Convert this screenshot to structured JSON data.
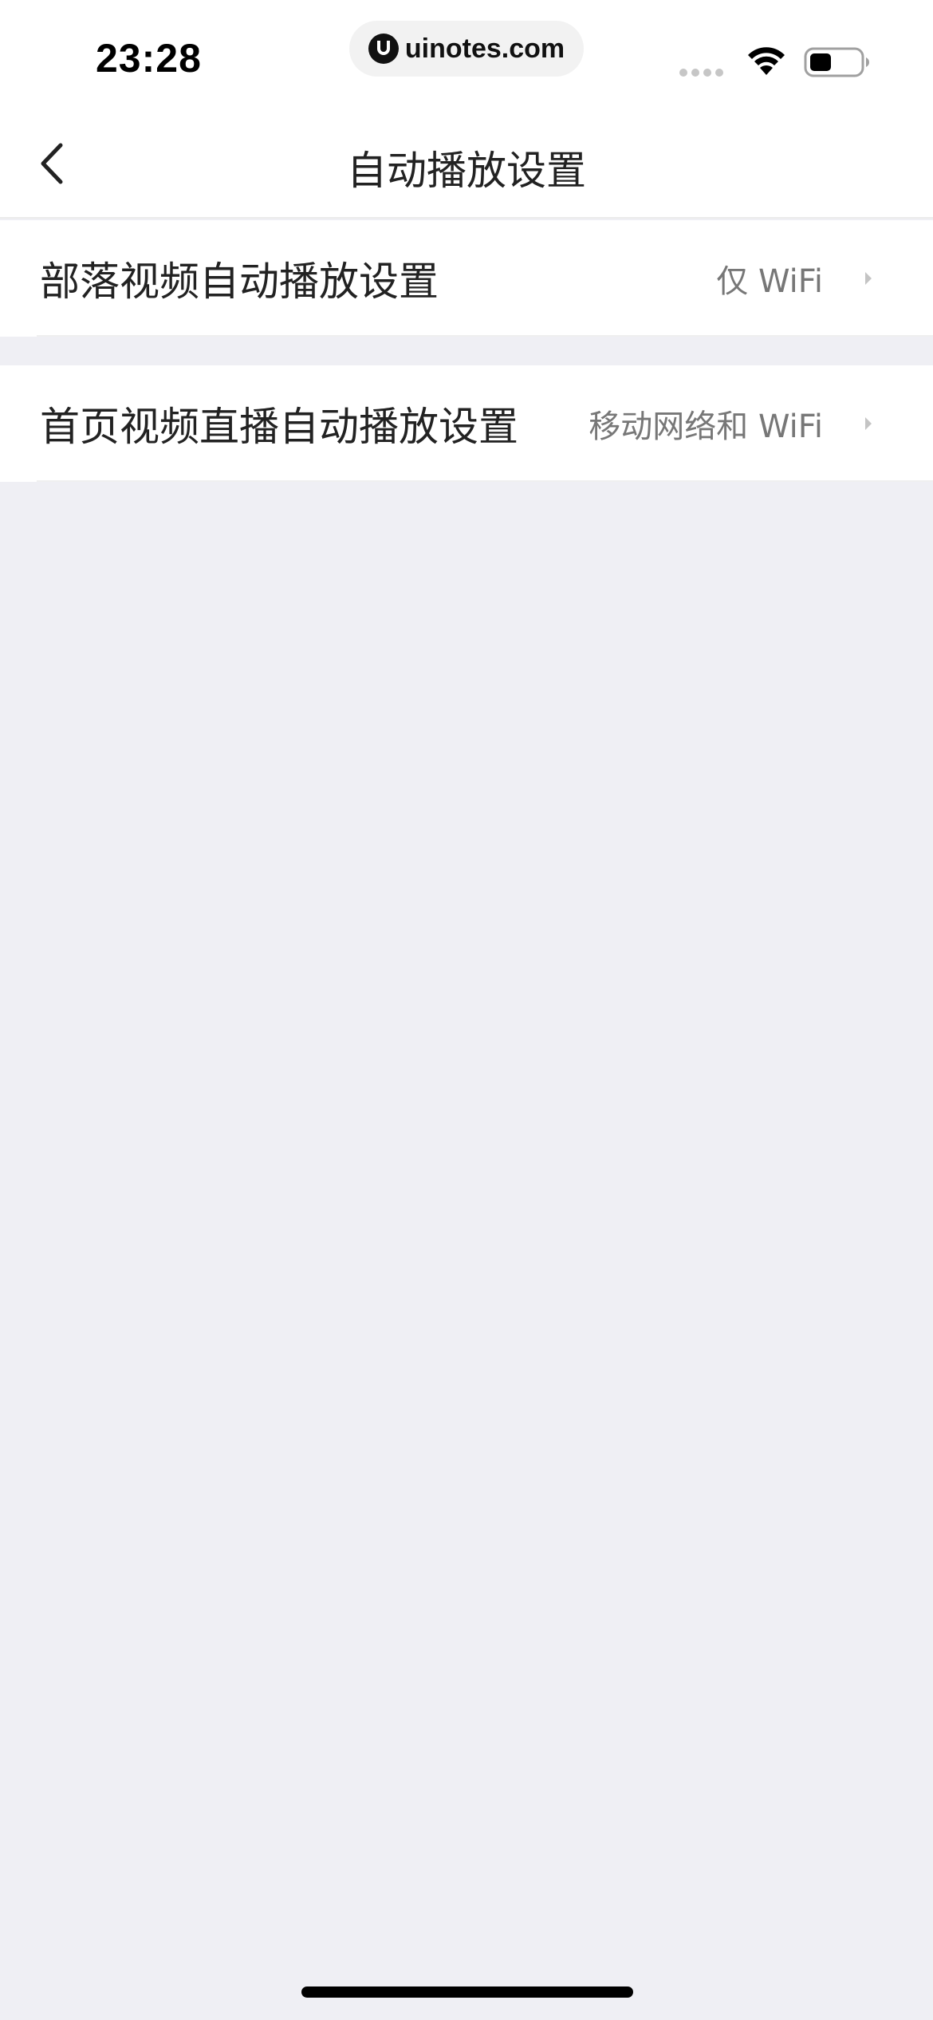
{
  "status_bar": {
    "time": "23:28",
    "url": "uinotes.com"
  },
  "nav": {
    "title": "自动播放设置",
    "back_icon": "chevron-left-icon"
  },
  "settings": [
    {
      "label": "部落视频自动播放设置",
      "value": "仅 WiFi"
    },
    {
      "label": "首页视频直播自动播放设置",
      "value": "移动网络和 WiFi"
    }
  ],
  "colors": {
    "background": "#efeff4",
    "surface": "#ffffff",
    "label": "#222222",
    "value": "#777777",
    "chevron": "#c4c4c4"
  }
}
